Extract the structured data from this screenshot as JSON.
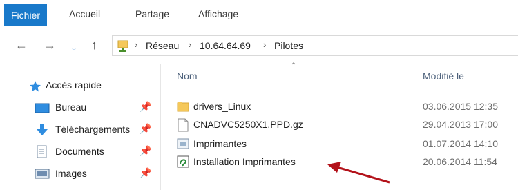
{
  "ribbon": {
    "tabs": [
      "Fichier",
      "Accueil",
      "Partage",
      "Affichage"
    ]
  },
  "address": {
    "back_icon": "arrow-left-icon",
    "forward_icon": "arrow-right-icon",
    "history_icon": "chevron-down-icon",
    "up_icon": "arrow-up-icon",
    "crumbs": [
      "Réseau",
      "10.64.64.69",
      "Pilotes"
    ]
  },
  "sidebar": {
    "quick_access": "Accès rapide",
    "items": [
      {
        "label": "Bureau",
        "icon": "desktop-icon"
      },
      {
        "label": "Téléchargements",
        "icon": "download-icon"
      },
      {
        "label": "Documents",
        "icon": "document-icon"
      },
      {
        "label": "Images",
        "icon": "image-icon"
      }
    ]
  },
  "file_list": {
    "columns": {
      "name": "Nom",
      "modified": "Modifié le"
    },
    "rows": [
      {
        "name": "drivers_Linux",
        "modified": "03.06.2015 12:35",
        "icon": "folder-icon"
      },
      {
        "name": "CNADVC5250X1.PPD.gz",
        "modified": "29.04.2013 17:00",
        "icon": "file-icon"
      },
      {
        "name": "Imprimantes",
        "modified": "01.07.2014 14:10",
        "icon": "printer-shortcut-icon"
      },
      {
        "name": "Installation Imprimantes",
        "modified": "20.06.2014 11:54",
        "icon": "installer-icon"
      }
    ]
  },
  "colors": {
    "accent": "#1979ca",
    "arrow": "#b3121a",
    "folder": "#f5c85a"
  }
}
